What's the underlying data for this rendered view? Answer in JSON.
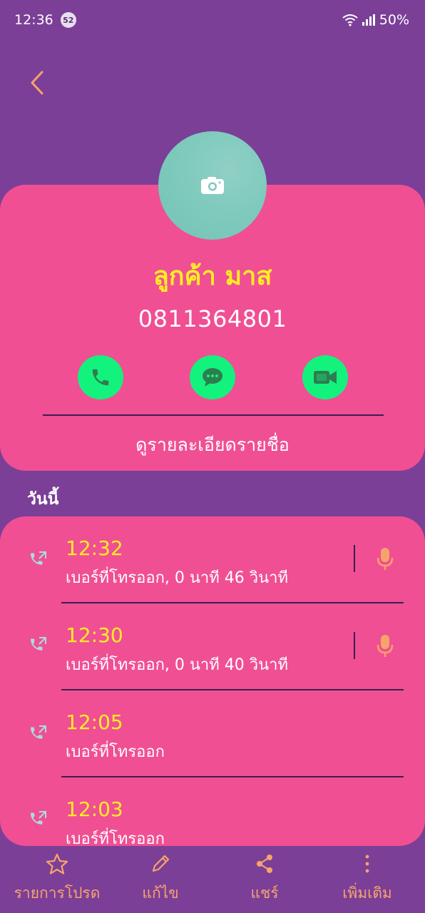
{
  "status_bar": {
    "time": "12:36",
    "notification_count": "52",
    "battery": "50%"
  },
  "contact": {
    "name": "ลูกค้า มาส",
    "phone": "0811364801",
    "view_details": "ดูรายละเอียดรายชื่อ"
  },
  "section": {
    "today": "วันนี้"
  },
  "calls": [
    {
      "time": "12:32",
      "description": "เบอร์ที่โทรออก, 0 นาที 46 วินาที"
    },
    {
      "time": "12:30",
      "description": "เบอร์ที่โทรออก, 0 นาที 40 วินาที"
    },
    {
      "time": "12:05",
      "description": "เบอร์ที่โทรออก"
    },
    {
      "time": "12:03",
      "description": "เบอร์ที่โทรออก"
    }
  ],
  "nav": {
    "favorites": "รายการโปรด",
    "edit": "แก้ไข",
    "share": "แชร์",
    "more": "เพิ่มเติม"
  },
  "colors": {
    "background": "#7b3f98",
    "card": "#f04f94",
    "accent_yellow": "#ffee22",
    "action_green": "#14f27e",
    "nav_orange": "#f7a46a"
  },
  "icons": [
    "back-chevron-icon",
    "camera-icon",
    "phone-icon",
    "message-icon",
    "video-call-icon",
    "outgoing-call-icon",
    "microphone-icon",
    "star-icon",
    "pencil-icon",
    "share-icon",
    "more-vertical-icon"
  ]
}
